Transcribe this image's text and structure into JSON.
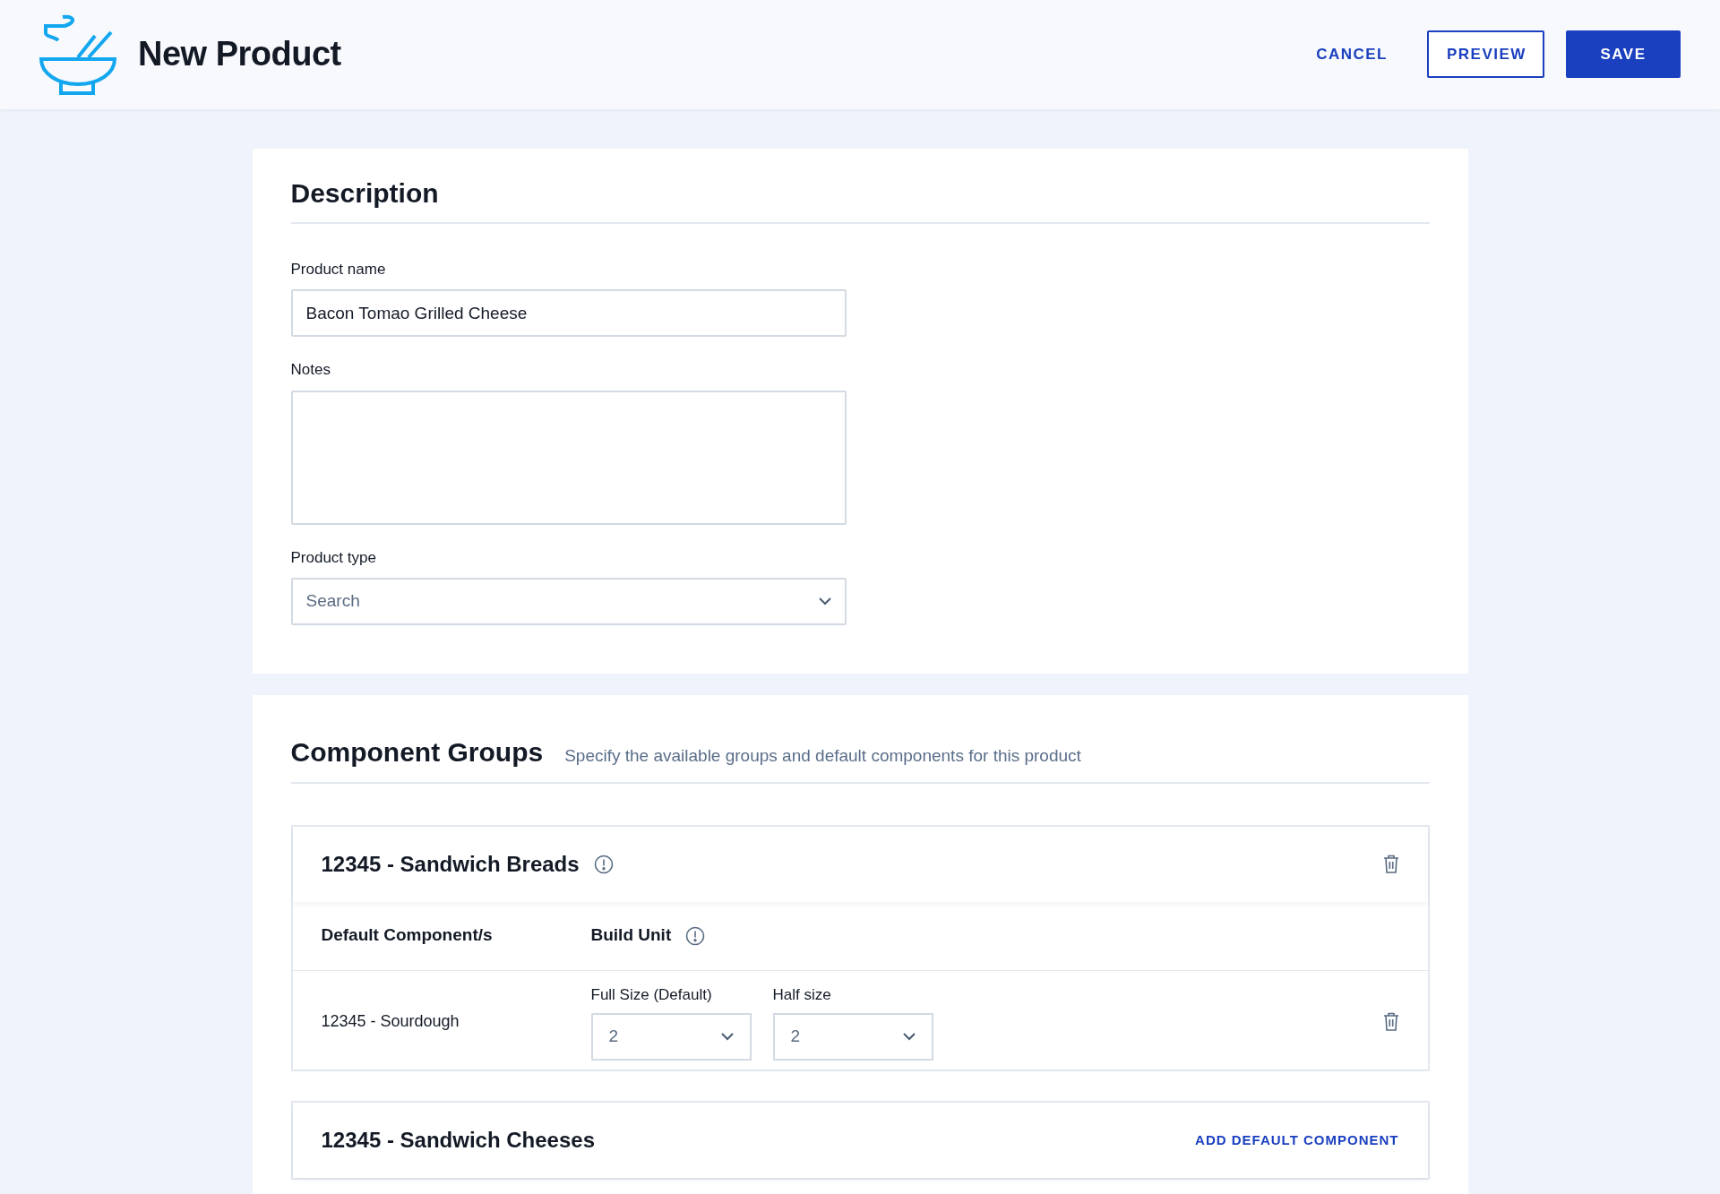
{
  "header": {
    "title": "New Product",
    "actions": [
      {
        "label": "CANCEL",
        "kind": "link"
      },
      {
        "label": "PREVIEW",
        "kind": "outline"
      },
      {
        "label": "SAVE",
        "kind": "primary"
      }
    ]
  },
  "description": {
    "title": "Description",
    "fields": [
      {
        "label": "Product name",
        "kind": "text",
        "value": "Bacon Tomao Grilled Cheese"
      },
      {
        "label": "Notes",
        "kind": "textarea"
      },
      {
        "label": "Product type",
        "kind": "select",
        "placeholder": "Search"
      }
    ]
  },
  "component_groups": {
    "title": "Component Groups",
    "subtitle": "Specify the available groups and default components for this product",
    "groups": [
      {
        "title": "12345 - Sandwich Breads",
        "info": true,
        "columns": [
          "Default Component/s",
          "Build Unit"
        ],
        "rows": [
          {
            "name": "12345 - Sourdough",
            "units": [
              {
                "label": "Full Size (Default)",
                "value": "2"
              },
              {
                "label": "Half size",
                "value": "2"
              }
            ]
          }
        ]
      },
      {
        "title": "12345 - Sandwich Cheeses",
        "info": false,
        "action": "ADD DEFAULT COMPONENT"
      }
    ]
  }
}
